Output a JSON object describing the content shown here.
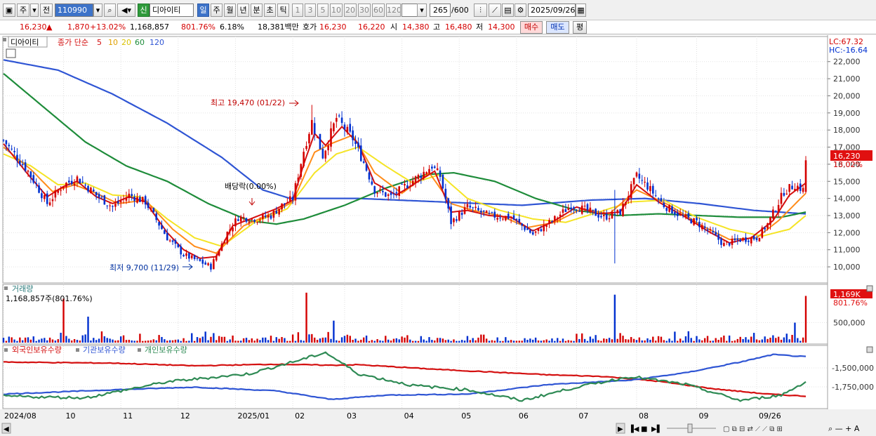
{
  "toolbar": {
    "period_type": "주",
    "prev_label": "전",
    "code": "110990",
    "new_badge": "신",
    "stock_name": "디아이티",
    "timeframes": [
      "일",
      "주",
      "월",
      "년",
      "분",
      "초",
      "틱"
    ],
    "active_timeframe": "일",
    "intervals": [
      "1",
      "3",
      "5",
      "10",
      "20",
      "30",
      "60",
      "120"
    ],
    "count": "265",
    "count_max": "/600",
    "date": "2025/09/26"
  },
  "quote": {
    "price": "16,230",
    "arrow": "▲",
    "change": "1,870",
    "change_pct": "+13.02%",
    "volume": "1,168,857",
    "volume_pct": "801.76%",
    "turnover": "6.18%",
    "amount": "18,381백만",
    "ask_label": "호가",
    "ask": "16,230",
    "bid": "16,220",
    "open_label": "시",
    "open": "14,380",
    "high_label": "고",
    "high": "16,480",
    "low_label": "저",
    "low": "14,300",
    "buy_label": "매수",
    "sell_label": "매도",
    "eval_label": "평"
  },
  "colors": {
    "up": "#d40000",
    "down": "#0030d0",
    "ma5": "#d41010",
    "ma10": "#ff8c1a",
    "ma20": "#f5e425",
    "ma60": "#1e8c3a",
    "ma120": "#2f55d4",
    "foreign": "#d41010",
    "inst": "#2f55d4",
    "indiv": "#2e8a54"
  },
  "price_panel": {
    "name": "디아이티",
    "ma_label": "종가 단순",
    "ma_periods": [
      "5",
      "10",
      "20",
      "60",
      "120"
    ],
    "lc": "LC:67.32",
    "hc": "HC:-16.64",
    "max_label": "최고 19,470 (01/22)",
    "min_label": "최저 9,700 (11/29)",
    "div_label": "배당락(0.00%)",
    "last_price": "16,230",
    "last_pct": "13.02%"
  },
  "volume_panel": {
    "title": "거래량",
    "value": "1,168,857주(801.76%)",
    "last": "1,169K",
    "last_pct": "801.76%"
  },
  "holdings_panel": {
    "legend": [
      "외국인보유수량",
      "기관보유수량",
      "개인보유수량"
    ]
  },
  "x_labels": [
    "2024/08",
    "10",
    "11",
    "12",
    "2025/01",
    "02",
    "03",
    "04",
    "05",
    "06",
    "07",
    "08",
    "09",
    "09/26"
  ],
  "chart_data": [
    {
      "type": "candlestick",
      "title": "디아이티",
      "y_ticks": [
        10000,
        11000,
        12000,
        13000,
        14000,
        15000,
        16000,
        17000,
        18000,
        19000,
        20000,
        21000,
        22000
      ],
      "y_tick_labels": [
        "10,000",
        "11,000",
        "12,000",
        "13,000",
        "14,000",
        "15,000",
        "16,000",
        "17,000",
        "18,000",
        "19,000",
        "20,000",
        "21,000",
        "22,000"
      ],
      "ylim": [
        9100,
        22400
      ],
      "x_range": [
        "2024/08",
        "2025/09/26"
      ],
      "close_trend": [
        [
          0,
          17400
        ],
        [
          9,
          15600
        ],
        [
          16,
          13700
        ],
        [
          22,
          14800
        ],
        [
          27,
          15200
        ],
        [
          34,
          14200
        ],
        [
          40,
          13500
        ],
        [
          46,
          14200
        ],
        [
          52,
          13800
        ],
        [
          60,
          11700
        ],
        [
          66,
          10700
        ],
        [
          72,
          10300
        ],
        [
          76,
          10000
        ],
        [
          82,
          12000
        ],
        [
          86,
          12900
        ],
        [
          93,
          12800
        ],
        [
          98,
          13000
        ],
        [
          102,
          13600
        ],
        [
          106,
          14000
        ],
        [
          110,
          16800
        ],
        [
          113,
          18500
        ],
        [
          117,
          16500
        ],
        [
          122,
          18700
        ],
        [
          128,
          17500
        ],
        [
          132,
          16100
        ],
        [
          136,
          14500
        ],
        [
          142,
          14100
        ],
        [
          147,
          14700
        ],
        [
          153,
          15400
        ],
        [
          157,
          15900
        ],
        [
          160,
          15300
        ],
        [
          164,
          12600
        ],
        [
          170,
          13500
        ],
        [
          178,
          13000
        ],
        [
          186,
          12900
        ],
        [
          194,
          11900
        ],
        [
          202,
          12800
        ],
        [
          208,
          13600
        ],
        [
          214,
          13300
        ],
        [
          220,
          12900
        ],
        [
          226,
          13200
        ],
        [
          232,
          15300
        ],
        [
          236,
          14700
        ],
        [
          242,
          13600
        ],
        [
          248,
          13000
        ],
        [
          254,
          12600
        ],
        [
          260,
          11900
        ],
        [
          264,
          11300
        ],
        [
          270,
          11600
        ],
        [
          276,
          11700
        ],
        [
          280,
          12500
        ],
        [
          286,
          14400
        ],
        [
          290,
          14800
        ],
        [
          293,
          14500
        ],
        [
          294,
          16230
        ]
      ],
      "ma5_trend": [
        [
          0,
          17200
        ],
        [
          9,
          15400
        ],
        [
          16,
          14100
        ],
        [
          22,
          14700
        ],
        [
          27,
          15000
        ],
        [
          34,
          14100
        ],
        [
          40,
          13700
        ],
        [
          46,
          14100
        ],
        [
          52,
          13800
        ],
        [
          60,
          12000
        ],
        [
          66,
          11000
        ],
        [
          72,
          10500
        ],
        [
          78,
          10600
        ],
        [
          84,
          12400
        ],
        [
          92,
          12900
        ],
        [
          100,
          13400
        ],
        [
          106,
          13900
        ],
        [
          110,
          16000
        ],
        [
          114,
          17800
        ],
        [
          118,
          17100
        ],
        [
          124,
          18200
        ],
        [
          130,
          17200
        ],
        [
          136,
          14900
        ],
        [
          144,
          14200
        ],
        [
          152,
          15000
        ],
        [
          158,
          15600
        ],
        [
          164,
          13200
        ],
        [
          170,
          13300
        ],
        [
          178,
          13000
        ],
        [
          186,
          12900
        ],
        [
          194,
          12100
        ],
        [
          202,
          12700
        ],
        [
          210,
          13500
        ],
        [
          218,
          13100
        ],
        [
          226,
          13200
        ],
        [
          232,
          14800
        ],
        [
          240,
          13800
        ],
        [
          250,
          12900
        ],
        [
          258,
          12100
        ],
        [
          266,
          11400
        ],
        [
          274,
          11700
        ],
        [
          282,
          12700
        ],
        [
          288,
          14200
        ],
        [
          294,
          14900
        ]
      ],
      "ma10_trend": [
        [
          0,
          17000
        ],
        [
          10,
          15700
        ],
        [
          18,
          14400
        ],
        [
          26,
          14800
        ],
        [
          34,
          14300
        ],
        [
          42,
          13700
        ],
        [
          52,
          13900
        ],
        [
          62,
          12200
        ],
        [
          70,
          11200
        ],
        [
          78,
          10800
        ],
        [
          88,
          12400
        ],
        [
          98,
          13100
        ],
        [
          106,
          13800
        ],
        [
          114,
          16700
        ],
        [
          120,
          17200
        ],
        [
          128,
          17700
        ],
        [
          136,
          15500
        ],
        [
          146,
          14300
        ],
        [
          156,
          15500
        ],
        [
          164,
          13700
        ],
        [
          172,
          13300
        ],
        [
          182,
          13000
        ],
        [
          192,
          12300
        ],
        [
          202,
          12600
        ],
        [
          212,
          13400
        ],
        [
          222,
          13100
        ],
        [
          232,
          14500
        ],
        [
          244,
          13600
        ],
        [
          256,
          12400
        ],
        [
          266,
          11600
        ],
        [
          276,
          11700
        ],
        [
          284,
          12700
        ],
        [
          294,
          14300
        ]
      ],
      "ma20_trend": [
        [
          0,
          16600
        ],
        [
          10,
          15900
        ],
        [
          20,
          14800
        ],
        [
          30,
          14900
        ],
        [
          40,
          14200
        ],
        [
          50,
          14100
        ],
        [
          60,
          12800
        ],
        [
          70,
          11700
        ],
        [
          80,
          11200
        ],
        [
          92,
          12600
        ],
        [
          104,
          13400
        ],
        [
          114,
          15500
        ],
        [
          122,
          16600
        ],
        [
          130,
          17000
        ],
        [
          140,
          15900
        ],
        [
          150,
          14900
        ],
        [
          160,
          15400
        ],
        [
          170,
          14000
        ],
        [
          182,
          13300
        ],
        [
          194,
          12800
        ],
        [
          206,
          12600
        ],
        [
          218,
          13200
        ],
        [
          230,
          13800
        ],
        [
          242,
          13900
        ],
        [
          254,
          12900
        ],
        [
          266,
          12200
        ],
        [
          278,
          11800
        ],
        [
          288,
          12200
        ],
        [
          294,
          13000
        ]
      ],
      "ma60_trend": [
        [
          0,
          21300
        ],
        [
          15,
          19300
        ],
        [
          30,
          17300
        ],
        [
          45,
          15900
        ],
        [
          60,
          15000
        ],
        [
          75,
          13700
        ],
        [
          90,
          12700
        ],
        [
          100,
          12500
        ],
        [
          110,
          12800
        ],
        [
          125,
          13600
        ],
        [
          140,
          14600
        ],
        [
          155,
          15400
        ],
        [
          165,
          15500
        ],
        [
          180,
          15000
        ],
        [
          195,
          14000
        ],
        [
          210,
          13300
        ],
        [
          225,
          13000
        ],
        [
          240,
          13100
        ],
        [
          255,
          13000
        ],
        [
          270,
          12900
        ],
        [
          285,
          12900
        ],
        [
          294,
          13200
        ]
      ],
      "ma120_trend": [
        [
          0,
          22100
        ],
        [
          20,
          21500
        ],
        [
          40,
          20100
        ],
        [
          60,
          18400
        ],
        [
          80,
          16400
        ],
        [
          95,
          14500
        ],
        [
          105,
          14000
        ],
        [
          130,
          14000
        ],
        [
          160,
          13800
        ],
        [
          190,
          13600
        ],
        [
          215,
          13900
        ],
        [
          235,
          14000
        ],
        [
          255,
          13700
        ],
        [
          275,
          13300
        ],
        [
          294,
          13100
        ]
      ]
    },
    {
      "type": "bar",
      "title": "거래량",
      "y_ticks": [
        500000
      ],
      "y_tick_labels": [
        "500,000"
      ],
      "ylim": [
        0,
        1300000
      ],
      "spikes": [
        [
          22,
          1100000
        ],
        [
          31,
          650000
        ],
        [
          108,
          260000
        ],
        [
          111,
          1250000
        ],
        [
          121,
          550000
        ],
        [
          224,
          1200000
        ],
        [
          290,
          500000
        ],
        [
          294,
          1168857
        ]
      ]
    },
    {
      "type": "line",
      "title": "외국인보유수량",
      "y_ticks": [
        -1500000,
        -1750000
      ],
      "y_tick_labels": [
        "-1,500,000",
        "-1,750,000"
      ],
      "series": [
        {
          "name": "외국인보유수량",
          "points": [
            [
              0,
              0.82
            ],
            [
              40,
              0.8
            ],
            [
              70,
              0.75
            ],
            [
              100,
              0.78
            ],
            [
              120,
              0.76
            ],
            [
              130,
              0.77
            ],
            [
              160,
              0.68
            ],
            [
              200,
              0.58
            ],
            [
              220,
              0.55
            ],
            [
              240,
              0.46
            ],
            [
              260,
              0.32
            ],
            [
              280,
              0.22
            ],
            [
              294,
              0.18
            ]
          ]
        },
        {
          "name": "기관보유수량",
          "points": [
            [
              0,
              0.22
            ],
            [
              40,
              0.3
            ],
            [
              70,
              0.35
            ],
            [
              100,
              0.28
            ],
            [
              120,
              0.12
            ],
            [
              140,
              0.2
            ],
            [
              170,
              0.22
            ],
            [
              200,
              0.4
            ],
            [
              230,
              0.48
            ],
            [
              250,
              0.62
            ],
            [
              270,
              0.82
            ],
            [
              282,
              0.96
            ],
            [
              294,
              0.92
            ]
          ]
        },
        {
          "name": "개인보유수량",
          "points": [
            [
              0,
              0.18
            ],
            [
              30,
              0.15
            ],
            [
              60,
              0.45
            ],
            [
              90,
              0.6
            ],
            [
              108,
              0.85
            ],
            [
              118,
              1.0
            ],
            [
              130,
              0.6
            ],
            [
              150,
              0.38
            ],
            [
              170,
              0.3
            ],
            [
              190,
              0.1
            ],
            [
              210,
              0.35
            ],
            [
              230,
              0.55
            ],
            [
              250,
              0.4
            ],
            [
              270,
              0.1
            ],
            [
              285,
              0.2
            ],
            [
              294,
              0.45
            ]
          ]
        }
      ]
    }
  ]
}
